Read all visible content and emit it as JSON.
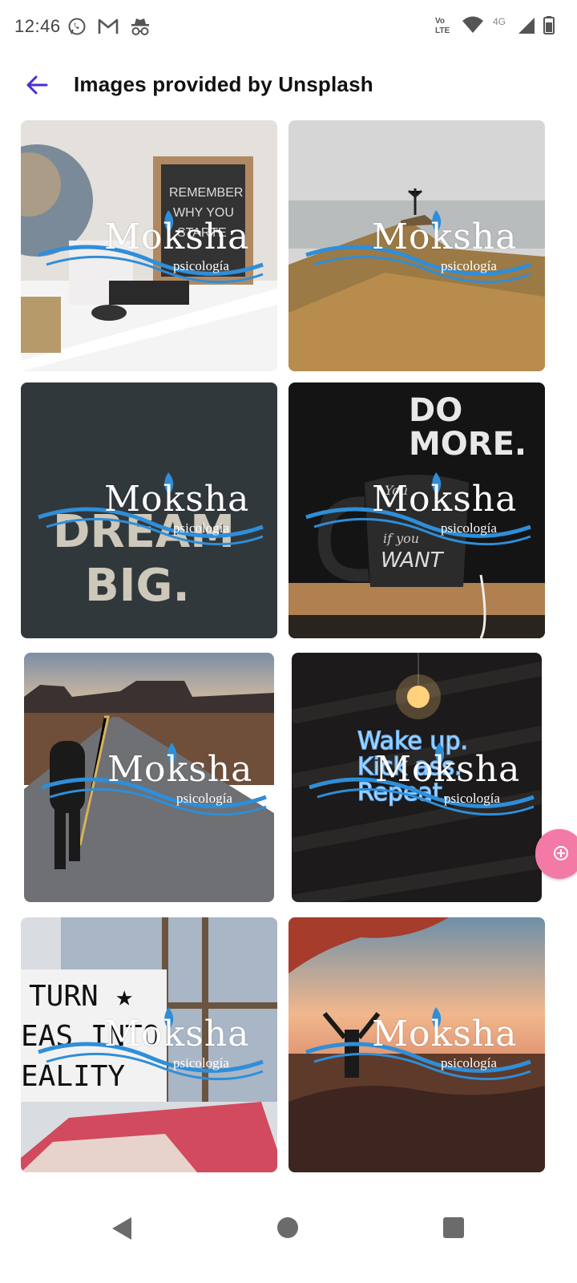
{
  "status_bar": {
    "time": "12:46",
    "left_icons": [
      "whatsapp-icon",
      "gmail-icon",
      "incognito-icon"
    ],
    "right_icons": [
      "volte-icon",
      "wifi-icon",
      "network-4g-icon",
      "signal-icon",
      "battery-icon"
    ],
    "volte_label_top": "Vo",
    "volte_label_bottom": "LTE",
    "network_label": "4G"
  },
  "app_bar": {
    "title": "Images provided by Unsplash",
    "back_icon": "arrow-left-icon",
    "accent_color": "#4a2bd6"
  },
  "watermark": {
    "brand": "Moksha",
    "sub": "psicología"
  },
  "images": [
    {
      "subject": "letter board and globe on shelf",
      "board_text": [
        "REMEMBER",
        "WHY YOU",
        "STARTE"
      ]
    },
    {
      "subject": "person on mountain peak"
    },
    {
      "subject": "chalk writing on dark wall",
      "wall_text": [
        "DREAM",
        "BIG."
      ]
    },
    {
      "subject": "black mug",
      "sign_text": [
        "DO",
        "MORE."
      ],
      "mug_text": [
        "You",
        "if you",
        "WANT"
      ]
    },
    {
      "subject": "person walking on desert road"
    },
    {
      "subject": "neon sign",
      "neon_text": [
        "Wake up.",
        "Kick ass.",
        "Repeat."
      ]
    },
    {
      "subject": "lightbox sign by window",
      "lightbox_text": [
        "TURN ★",
        "EAS INTO",
        "EALITY"
      ]
    },
    {
      "subject": "person with raised arms at sunset"
    }
  ],
  "fab": {
    "icon": "plus-circle-icon",
    "color": "#f37aa6"
  },
  "nav": {
    "back_icon": "nav-back-icon",
    "home_icon": "nav-home-icon",
    "recents_icon": "nav-recents-icon"
  }
}
